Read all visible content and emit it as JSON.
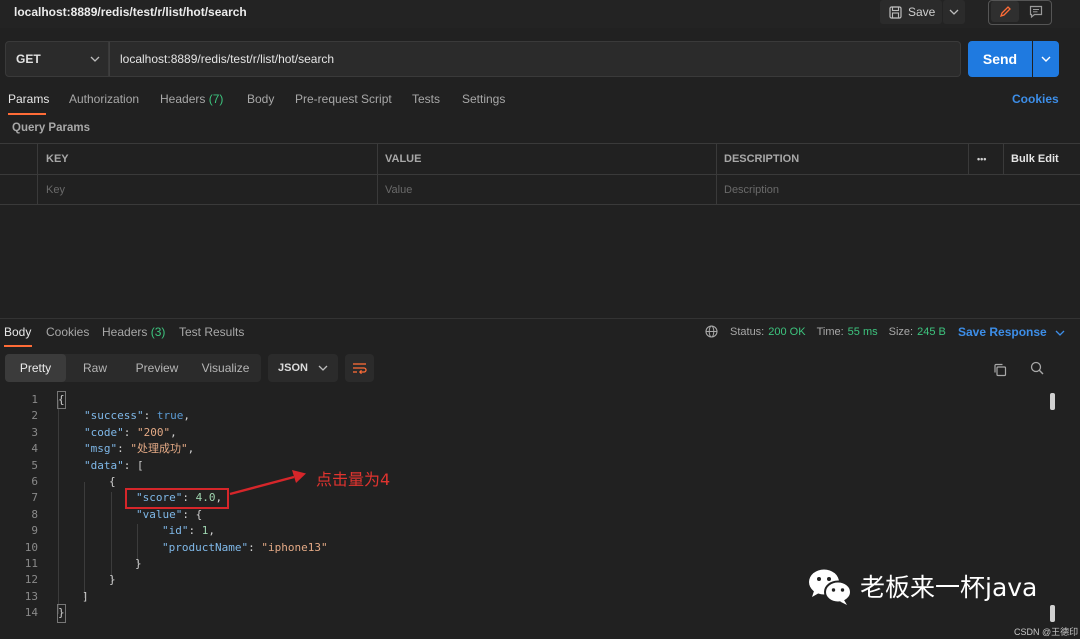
{
  "tab": {
    "title": "localhost:8889/redis/test/r/list/hot/search"
  },
  "toolbar": {
    "save_label": "Save"
  },
  "request": {
    "method": "GET",
    "url": "localhost:8889/redis/test/r/list/hot/search",
    "send_label": "Send"
  },
  "request_tabs": {
    "params": "Params",
    "authorization": "Authorization",
    "headers": "Headers",
    "headers_count": "(7)",
    "body": "Body",
    "prerequest": "Pre-request Script",
    "tests": "Tests",
    "settings": "Settings",
    "cookies": "Cookies"
  },
  "query_params": {
    "title": "Query Params",
    "columns": {
      "key": "KEY",
      "value": "VALUE",
      "description": "DESCRIPTION",
      "more": "•••",
      "bulk_edit": "Bulk Edit"
    },
    "placeholders": {
      "key": "Key",
      "value": "Value",
      "description": "Description"
    }
  },
  "response_tabs": {
    "body": "Body",
    "cookies": "Cookies",
    "headers": "Headers",
    "headers_count": "(3)",
    "test_results": "Test Results"
  },
  "response_status": {
    "status_label": "Status:",
    "status_value": "200 OK",
    "time_label": "Time:",
    "time_value": "55 ms",
    "size_label": "Size:",
    "size_value": "245 B",
    "save_response": "Save Response"
  },
  "view": {
    "pretty": "Pretty",
    "raw": "Raw",
    "preview": "Preview",
    "visualize": "Visualize",
    "format": "JSON"
  },
  "code": {
    "line_numbers": [
      "1",
      "2",
      "3",
      "4",
      "5",
      "6",
      "7",
      "8",
      "9",
      "10",
      "11",
      "12",
      "13",
      "14"
    ],
    "l1": "{",
    "l2_key": "\"success\"",
    "l2_val": "true",
    "l3_key": "\"code\"",
    "l3_val": "\"200\"",
    "l4_key": "\"msg\"",
    "l4_val": "\"处理成功\"",
    "l5_key": "\"data\"",
    "l5_val": "[",
    "l6": "{",
    "l7_key": "\"score\"",
    "l7_val": "4.0",
    "l8_key": "\"value\"",
    "l8_val": "{",
    "l9_key": "\"id\"",
    "l9_val": "1",
    "l10_key": "\"productName\"",
    "l10_val": "\"iphone13\"",
    "l11": "}",
    "l12": "}",
    "l13": "]",
    "l14": "}"
  },
  "annotation": {
    "text": "点击量为4"
  },
  "watermark": {
    "text": "老板来一杯java",
    "credit": "CSDN @王德印"
  },
  "colors": {
    "accent": "#ff6c37",
    "send": "#1f7ae0",
    "link": "#3d8ee8",
    "status_ok": "#3dc47e",
    "annotation": "#d6262a"
  }
}
